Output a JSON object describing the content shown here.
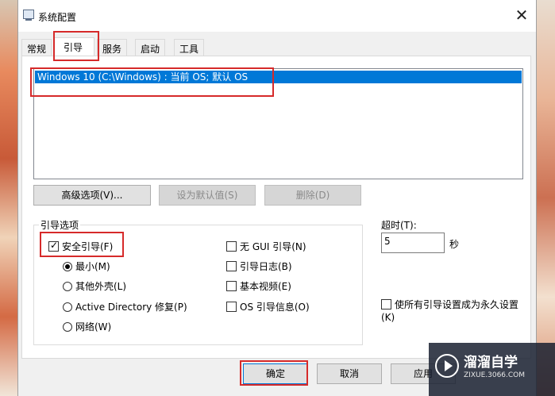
{
  "window": {
    "title": "系统配置",
    "close": "✕"
  },
  "tabs": [
    {
      "label": "常规"
    },
    {
      "label": "引导"
    },
    {
      "label": "服务"
    },
    {
      "label": "启动"
    },
    {
      "label": "工具"
    }
  ],
  "boot_list": {
    "entries": [
      "Windows 10 (C:\\Windows) : 当前 OS; 默认 OS"
    ]
  },
  "buttons": {
    "advanced": "高级选项(V)...",
    "set_default": "设为默认值(S)",
    "delete": "删除(D)"
  },
  "boot_options": {
    "group_label": "引导选项",
    "safe_boot": "安全引导(F)",
    "minimal": "最小(M)",
    "alternate_shell": "其他外壳(L)",
    "active_directory": "Active Directory 修复(P)",
    "network": "网络(W)",
    "no_gui": "无 GUI 引导(N)",
    "boot_log": "引导日志(B)",
    "base_video": "基本视频(E)",
    "os_boot_info": "OS 引导信息(O)"
  },
  "timeout": {
    "label": "超时(T):",
    "value": "5",
    "unit": "秒"
  },
  "make_permanent": "使所有引导设置成为永久设置(K)",
  "footer": {
    "ok": "确定",
    "cancel": "取消",
    "apply": "应用"
  },
  "watermark": {
    "title": "溜溜自学",
    "subtitle": "ZIXUE.3066.COM"
  }
}
